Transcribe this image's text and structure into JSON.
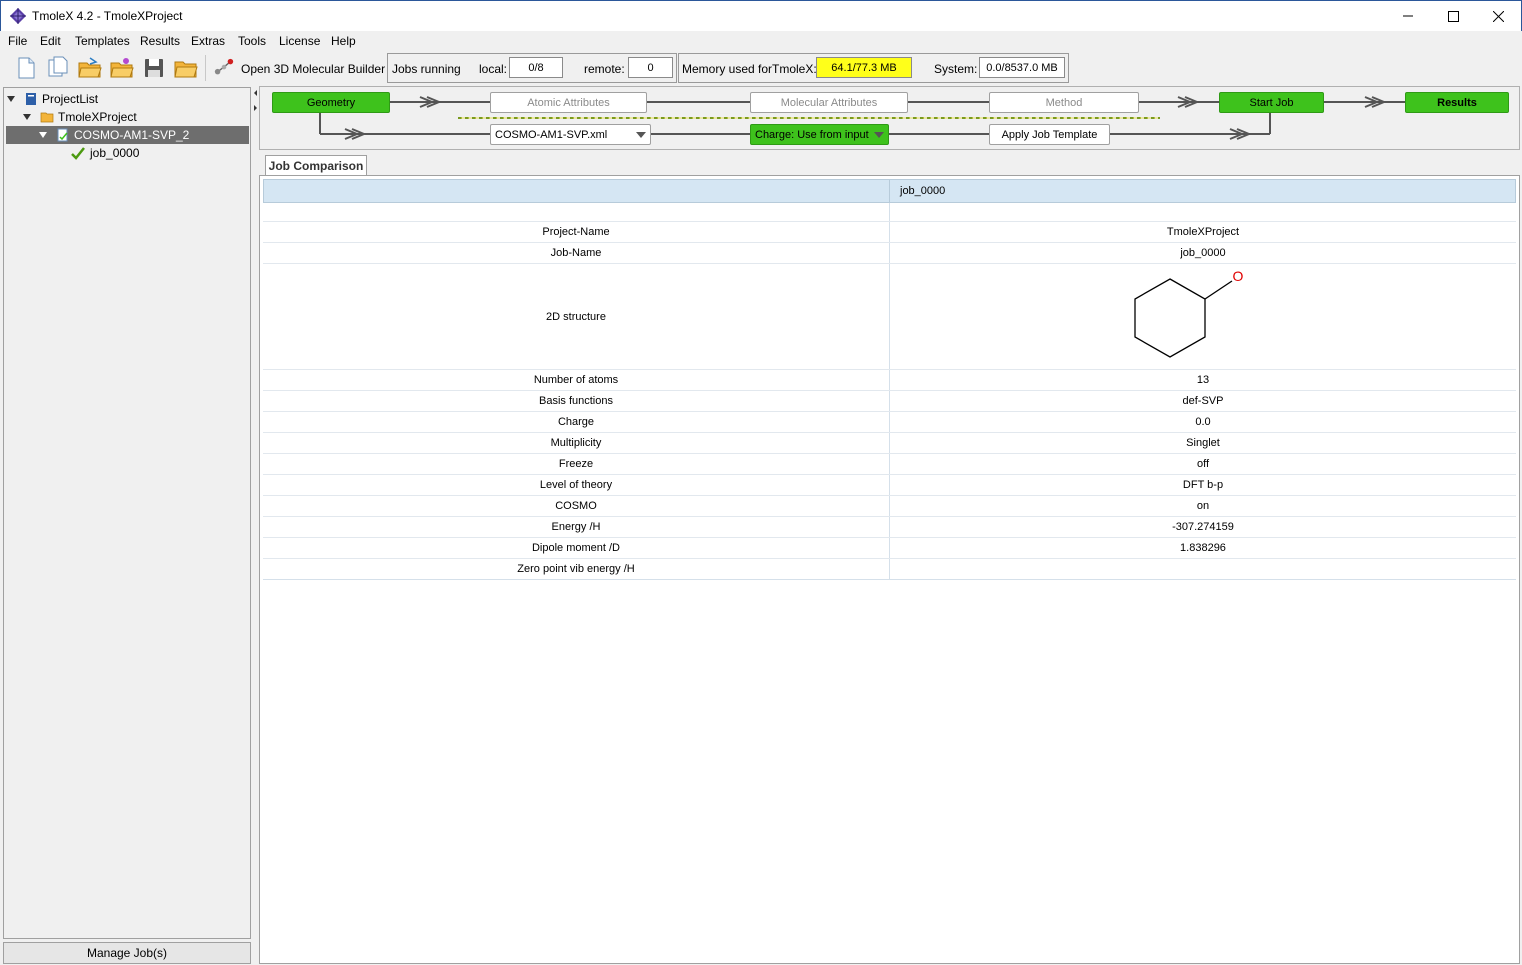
{
  "window": {
    "title": "TmoleX 4.2 - TmoleXProject"
  },
  "menu": [
    "File",
    "Edit",
    "Templates",
    "Results",
    "Extras",
    "Tools",
    "License",
    "Help"
  ],
  "toolbar": {
    "builder_label": "Open 3D Molecular Builder",
    "jobs_running_label": "Jobs running",
    "local_label": "local:",
    "local_value": "0/8",
    "remote_label": "remote:",
    "remote_value": "0",
    "memory_label": "Memory used for",
    "tmolex_label": "TmoleX:",
    "tmolex_value": "64.1/77.3 MB",
    "system_label": "System:",
    "system_value": "0.0/8537.0 MB"
  },
  "tree": {
    "root": "ProjectList",
    "project": "TmoleXProject",
    "subproject": "COSMO-AM1-SVP_2",
    "job": "job_0000"
  },
  "left_footer": "Manage Job(s)",
  "workflow": {
    "geometry": "Geometry",
    "atomic": "Atomic Attributes",
    "molecular": "Molecular Attributes",
    "method": "Method",
    "start": "Start Job",
    "results": "Results",
    "template_file": "COSMO-AM1-SVP.xml",
    "charge": "Charge:  Use from input",
    "apply_template": "Apply Job Template"
  },
  "tabs": [
    "Job Comparison"
  ],
  "table": {
    "column_header": "job_0000",
    "rows": [
      {
        "label": "Project-Name",
        "value": "TmoleXProject"
      },
      {
        "label": "Job-Name",
        "value": "job_0000"
      },
      {
        "label": "2D structure",
        "value": ""
      },
      {
        "label": "Number of atoms",
        "value": "13"
      },
      {
        "label": "Basis functions",
        "value": "def-SVP"
      },
      {
        "label": "Charge",
        "value": "0.0"
      },
      {
        "label": "Multiplicity",
        "value": "Singlet"
      },
      {
        "label": "Freeze",
        "value": "off"
      },
      {
        "label": "Level of theory",
        "value": "DFT b-p"
      },
      {
        "label": "COSMO",
        "value": "on"
      },
      {
        "label": "Energy /H",
        "value": "-307.274159"
      },
      {
        "label": "Dipole moment /D",
        "value": "1.838296"
      },
      {
        "label": "Zero point vib energy /H",
        "value": ""
      }
    ],
    "structure_atom_label": "O"
  },
  "colors": {
    "green_step": "#3ec21c",
    "memory_highlight": "#ffff1a",
    "header_bg": "#d5e6f3",
    "oxygen": "#e00000"
  }
}
